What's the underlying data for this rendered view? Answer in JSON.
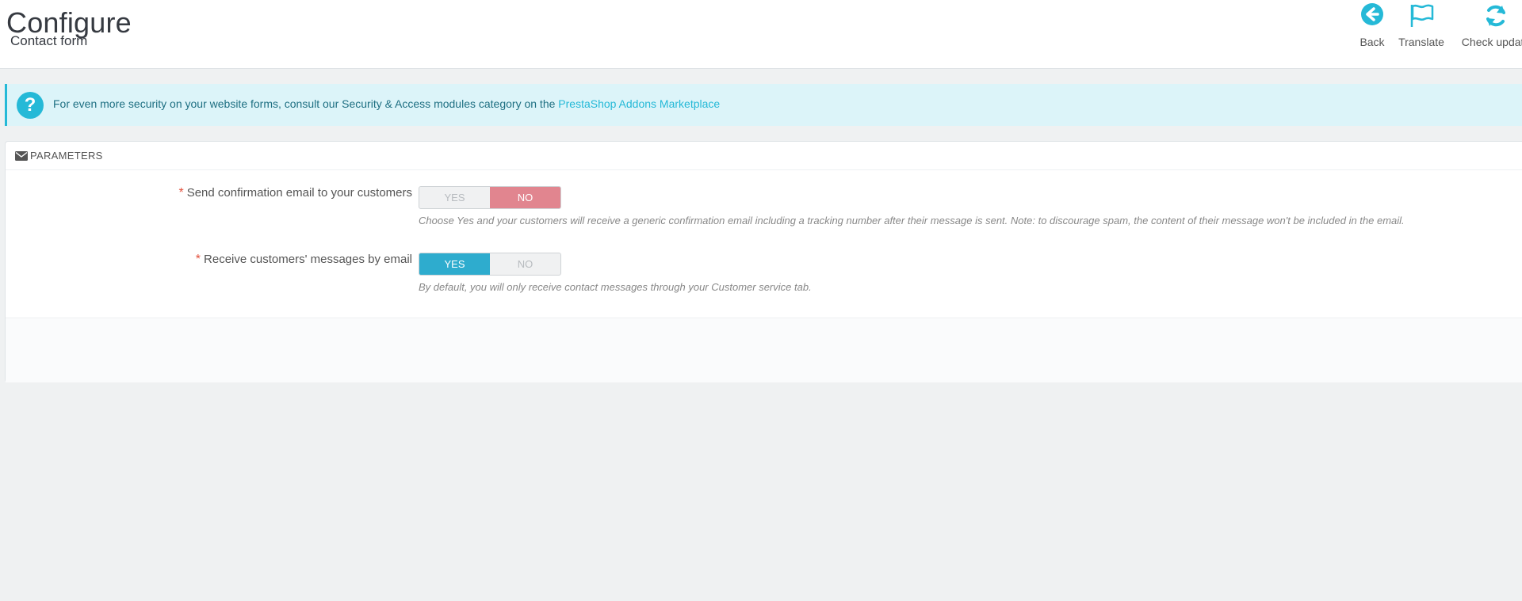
{
  "header": {
    "title": "Configure",
    "subtitle": "Contact form",
    "toolbar": {
      "back_label": "Back",
      "translate_label": "Translate",
      "check_label": "Check update"
    }
  },
  "alert": {
    "text": "For even more security on your website forms, consult our Security & Access modules category on the ",
    "link_text": "PrestaShop Addons Marketplace"
  },
  "panel": {
    "heading": "PARAMETERS",
    "fields": [
      {
        "required_mark": "*",
        "label": "Send confirmation email to your customers",
        "yes_label": "YES",
        "no_label": "NO",
        "value": "NO",
        "help": "Choose Yes and your customers will receive a generic confirmation email including a tracking number after their message is sent. Note: to discourage spam, the content of their message won't be included in the email."
      },
      {
        "required_mark": "*",
        "label": "Receive customers' messages by email",
        "yes_label": "YES",
        "no_label": "NO",
        "value": "YES",
        "help": "By default, you will only receive contact messages through your Customer service tab."
      }
    ]
  },
  "colors": {
    "accent": "#25b9d7",
    "no_active": "#e1858f",
    "yes_active": "#2eacce",
    "required": "#e2513d"
  },
  "icons": {
    "back": "arrow-circle-left-icon",
    "translate": "flag-icon",
    "check": "refresh-icon",
    "alert": "question-circle-icon",
    "panel": "envelope-icon"
  }
}
